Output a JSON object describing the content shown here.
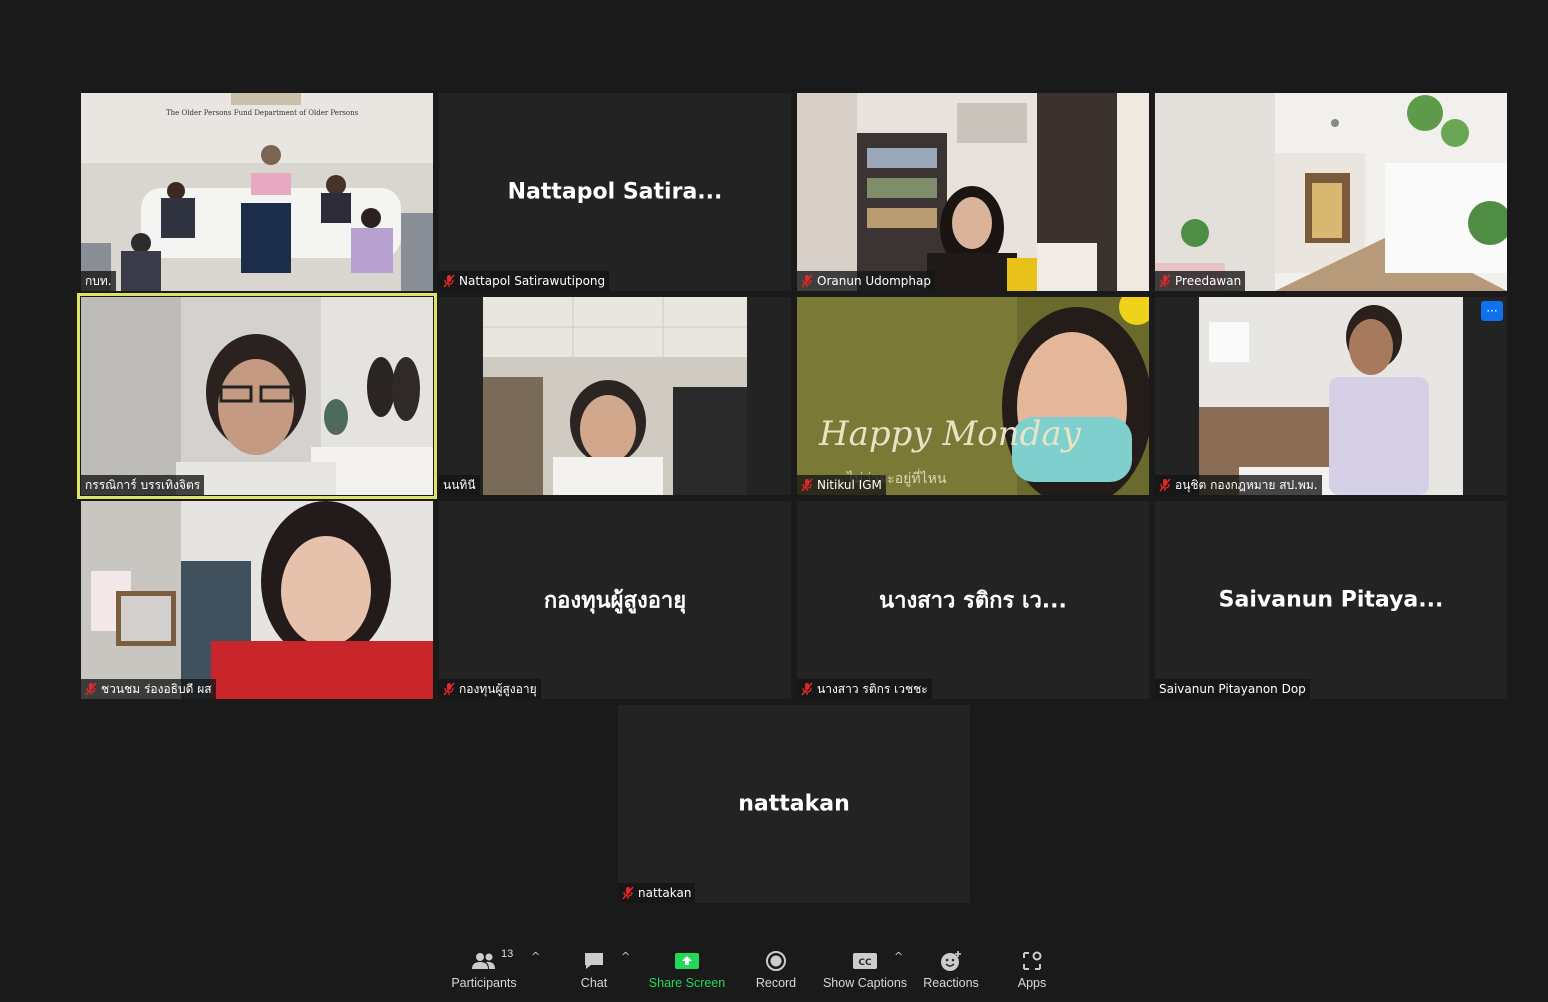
{
  "participants_grid": [
    {
      "display_name": "",
      "label": "กบท.",
      "muted": false,
      "video": "meeting-room"
    },
    {
      "display_name": "Nattapol  Satira...",
      "label": "Nattapol Satirawutipong",
      "muted": true,
      "video": null
    },
    {
      "display_name": "",
      "label": "Oranun Udomphap",
      "muted": true,
      "video": "woman-bookshelf"
    },
    {
      "display_name": "",
      "label": "Preedawan",
      "muted": true,
      "video": "white-interior"
    },
    {
      "display_name": "",
      "label": "กรรณิการ์ บรรเทิงจิตร",
      "muted": false,
      "video": "elderly-woman-glasses",
      "active_speaker": true
    },
    {
      "display_name": "",
      "label": "นนทินี",
      "muted": false,
      "video": "woman-office"
    },
    {
      "display_name": "",
      "label": "Nitikul IGM",
      "muted": true,
      "video": "happy-monday-mask",
      "overlay_text": "Happy Monday",
      "overlay_sub": "ไม่ว่าจะอยู่ที่ไหน"
    },
    {
      "display_name": "",
      "label": "อนุชิต กองกฎหมาย สป.พม.",
      "muted": true,
      "video": "man-shirt",
      "more_button": "···"
    },
    {
      "display_name": "",
      "label": "ชวนชม ร่องอธิบดี ผส",
      "muted": true,
      "video": "woman-red"
    },
    {
      "display_name": "กองทุนผู้สูงอายุ",
      "label": "กองทุนผู้สูงอายุ",
      "muted": true,
      "video": null
    },
    {
      "display_name": "นางสาว รติกร เว...",
      "label": "นางสาว รติกร เวชชะ",
      "muted": true,
      "video": null
    },
    {
      "display_name": "Saivanun  Pitaya...",
      "label": "Saivanun Pitayanon Dop",
      "muted": false,
      "video": null
    },
    {
      "display_name": "nattakan",
      "label": "nattakan",
      "muted": true,
      "video": null
    }
  ],
  "toolbar": {
    "participants_label": "Participants",
    "participants_count": "13",
    "chat_label": "Chat",
    "share_label": "Share Screen",
    "record_label": "Record",
    "captions_label": "Show Captions",
    "captions_icon_text": "CC",
    "reactions_label": "Reactions",
    "apps_label": "Apps"
  },
  "colors": {
    "background": "#1a1a1a",
    "tile": "#232323",
    "active_speaker": "#dde26a",
    "share_green": "#23d959",
    "muted_red": "#e02828",
    "more_blue": "#0e72ed"
  }
}
